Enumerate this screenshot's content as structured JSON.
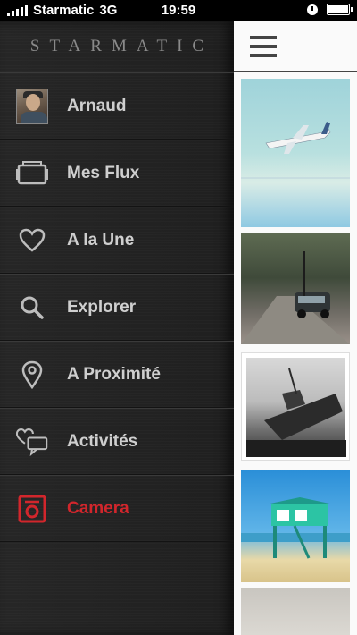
{
  "status_bar": {
    "carrier": "Starmatic",
    "network": "3G",
    "time": "19:59",
    "battery_level": 0.9
  },
  "menu": {
    "brand": "STARMATIC",
    "items": [
      {
        "label": "Arnaud",
        "icon": "avatar"
      },
      {
        "label": "Mes Flux",
        "icon": "photos-stack-icon"
      },
      {
        "label": "A la Une",
        "icon": "heart-icon"
      },
      {
        "label": "Explorer",
        "icon": "search-icon"
      },
      {
        "label": "A Proximité",
        "icon": "location-pin-icon"
      },
      {
        "label": "Activités",
        "icon": "chat-heart-icon"
      },
      {
        "label": "Camera",
        "icon": "camera-icon"
      }
    ]
  },
  "feed": {
    "menu_button_icon": "hamburger-icon",
    "photos": [
      "airplane-over-sea",
      "car-on-dirt-road",
      "shipwreck-black-white",
      "lifeguard-tower-beach",
      "partial-photo"
    ]
  },
  "colors": {
    "accent_red": "#d2262c",
    "menu_text": "#cfcfcf",
    "feed_background": "#fafafa"
  }
}
